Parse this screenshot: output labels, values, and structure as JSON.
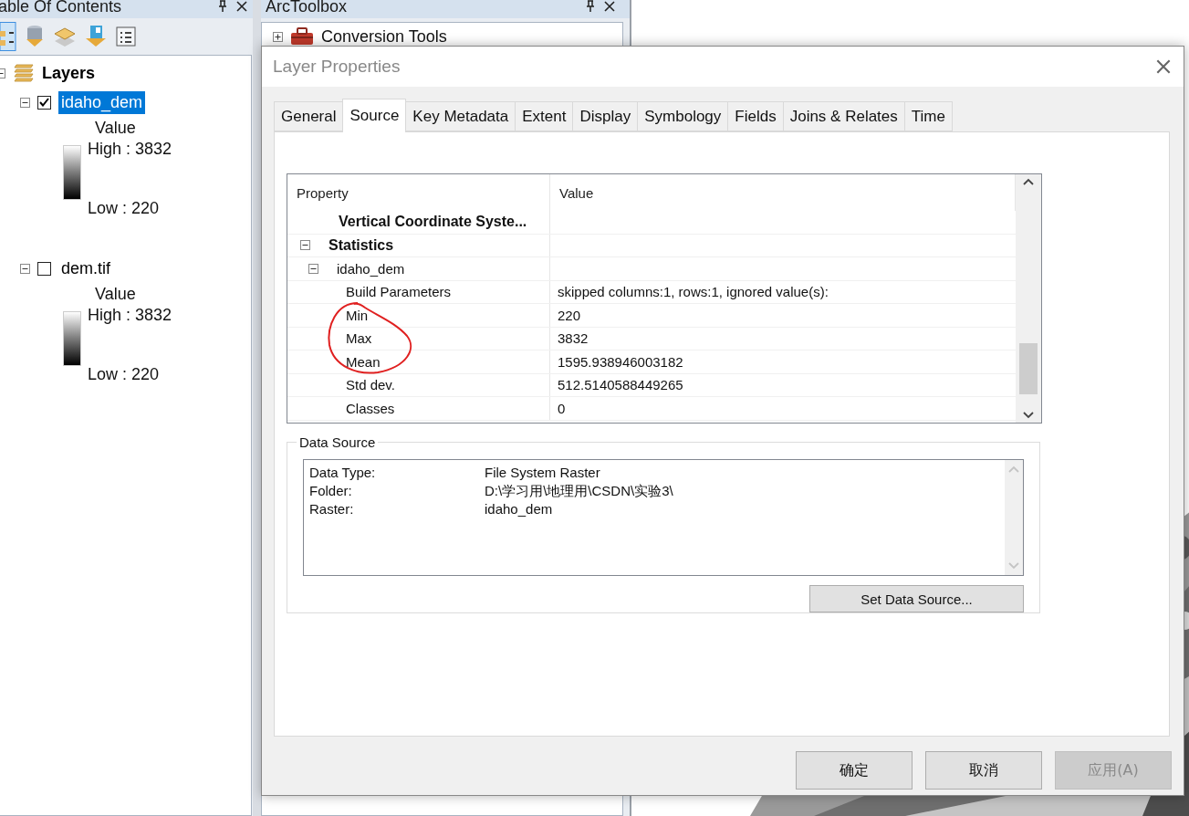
{
  "toc": {
    "title": "able Of Contents",
    "root": {
      "label": "Layers",
      "expanded": true,
      "children": [
        {
          "label": "idaho_dem",
          "checked": true,
          "selected": true,
          "expanded": true,
          "legend": {
            "field": "Value",
            "high": "High : 3832",
            "low": "Low : 220"
          }
        },
        {
          "label": "dem.tif",
          "checked": false,
          "selected": false,
          "expanded": true,
          "legend": {
            "field": "Value",
            "high": "High : 3832",
            "low": "Low : 220"
          }
        }
      ]
    }
  },
  "toolbox": {
    "title": "ArcToolbox",
    "items": [
      {
        "label": "Conversion Tools",
        "expanded": false
      }
    ]
  },
  "dialog": {
    "title": "Layer Properties",
    "tabs": [
      {
        "label": "General",
        "selected": false
      },
      {
        "label": "Source",
        "selected": true
      },
      {
        "label": "Key Metadata",
        "selected": false
      },
      {
        "label": "Extent",
        "selected": false
      },
      {
        "label": "Display",
        "selected": false
      },
      {
        "label": "Symbology",
        "selected": false
      },
      {
        "label": "Fields",
        "selected": false
      },
      {
        "label": "Joins & Relates",
        "selected": false
      },
      {
        "label": "Time",
        "selected": false
      }
    ],
    "property_grid": {
      "columns": [
        "Property",
        "Value"
      ],
      "items": [
        {
          "kind": "category",
          "name": "Vertical Coordinate Syste..."
        },
        {
          "kind": "category",
          "name": "Statistics",
          "expanded": true,
          "children": [
            {
              "kind": "group",
              "name": "idaho_dem",
              "expanded": true,
              "children": [
                {
                  "kind": "property",
                  "name": "Build Parameters",
                  "value": "skipped columns:1, rows:1, ignored value(s):"
                },
                {
                  "kind": "property",
                  "name": "Min",
                  "value": "220"
                },
                {
                  "kind": "property",
                  "name": "Max",
                  "value": "3832"
                },
                {
                  "kind": "property",
                  "name": "Mean",
                  "value": "1595.938946003182"
                },
                {
                  "kind": "property",
                  "name": "Std dev.",
                  "value": "512.5140588449265"
                },
                {
                  "kind": "property",
                  "name": "Classes",
                  "value": "0"
                }
              ]
            }
          ]
        }
      ]
    },
    "data_source": {
      "legend": "Data Source",
      "rows": [
        {
          "label": "Data Type:",
          "value": "File System Raster"
        },
        {
          "label": "Folder:",
          "value": "D:\\学习用\\地理用\\CSDN\\实验3\\"
        },
        {
          "label": "Raster:",
          "value": "idaho_dem"
        }
      ],
      "button": "Set Data Source..."
    },
    "buttons": [
      {
        "label": "确定",
        "disabled": false
      },
      {
        "label": "取消",
        "disabled": false
      },
      {
        "label": "应用(A)",
        "disabled": true
      }
    ]
  }
}
